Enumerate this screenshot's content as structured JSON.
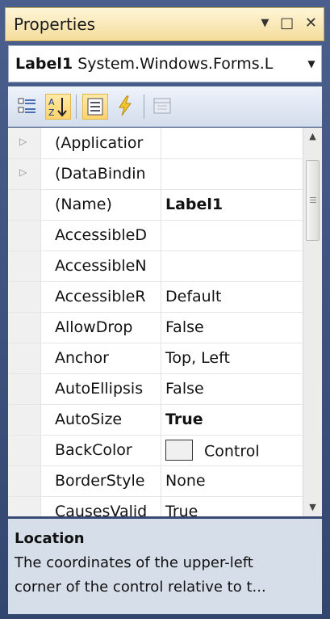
{
  "window": {
    "title": "Properties",
    "controls": {
      "dropdown": "▼",
      "maximize": "□",
      "close": "✕"
    }
  },
  "object_selector": {
    "name": "Label1",
    "type": "System.Windows.Forms.L",
    "arrow": "▼"
  },
  "toolbar": {
    "buttons": [
      {
        "icon": "categorized-icon",
        "active": false
      },
      {
        "icon": "alphabetical-icon",
        "active": true
      },
      {
        "icon": "properties-icon",
        "active": true
      },
      {
        "icon": "events-icon",
        "active": false
      },
      {
        "icon": "property-pages-icon",
        "active": false,
        "disabled": true
      }
    ],
    "alpha_top": "A",
    "alpha_bottom": "Z"
  },
  "grid": {
    "rows": [
      {
        "name": "(Applicatior",
        "value": "",
        "expandable": true,
        "bold": false
      },
      {
        "name": "(DataBindin",
        "value": "",
        "expandable": true,
        "bold": false
      },
      {
        "name": "(Name)",
        "value": "Label1",
        "expandable": false,
        "bold": true
      },
      {
        "name": "AccessibleD",
        "value": "",
        "expandable": false,
        "bold": false
      },
      {
        "name": "AccessibleN",
        "value": "",
        "expandable": false,
        "bold": false
      },
      {
        "name": "AccessibleR",
        "value": "Default",
        "expandable": false,
        "bold": false
      },
      {
        "name": "AllowDrop",
        "value": "False",
        "expandable": false,
        "bold": false
      },
      {
        "name": "Anchor",
        "value": "Top, Left",
        "expandable": false,
        "bold": false
      },
      {
        "name": "AutoEllipsis",
        "value": "False",
        "expandable": false,
        "bold": false
      },
      {
        "name": "AutoSize",
        "value": "True",
        "expandable": false,
        "bold": true
      },
      {
        "name": "BackColor",
        "value": "Control",
        "expandable": false,
        "bold": false,
        "swatch": "#f0f0f0"
      },
      {
        "name": "BorderStyle",
        "value": "None",
        "expandable": false,
        "bold": false
      },
      {
        "name": "CausesValid",
        "value": "True",
        "expandable": false,
        "bold": false
      }
    ]
  },
  "description": {
    "title": "Location",
    "text_line1": "The coordinates of the upper-left",
    "text_line2": "corner of the control relative to t..."
  },
  "colors": {
    "title_bar": "#f4dc9a",
    "frame": "#3b4f7a",
    "description_bg": "#d6deea",
    "toolbar_active": "#ffd36b"
  }
}
